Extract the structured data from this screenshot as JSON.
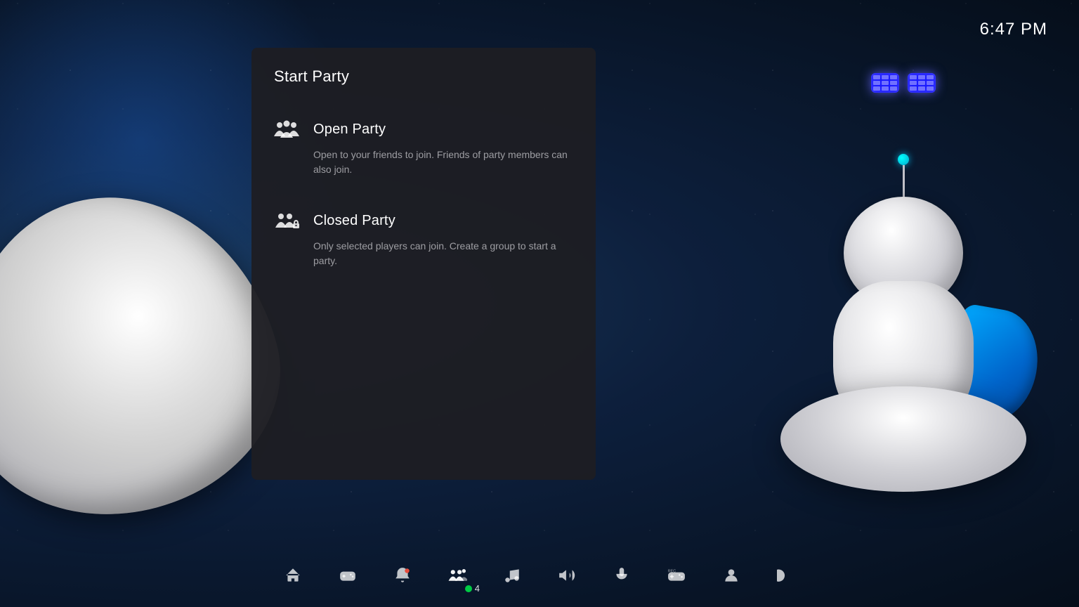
{
  "clock": {
    "time": "6:47 PM"
  },
  "panel": {
    "title": "Start Party",
    "items": [
      {
        "id": "open-party",
        "title": "Open Party",
        "description": "Open to your friends to join. Friends of party members can also join.",
        "icon": "open-party-icon"
      },
      {
        "id": "closed-party",
        "title": "Closed Party",
        "description": "Only selected players can join. Create a group to start a party.",
        "icon": "closed-party-icon"
      }
    ]
  },
  "taskbar": {
    "icons": [
      {
        "id": "home",
        "label": "Home"
      },
      {
        "id": "game",
        "label": "Game"
      },
      {
        "id": "notifications",
        "label": "Notifications"
      },
      {
        "id": "party",
        "label": "Party",
        "active": true,
        "badge": "4"
      },
      {
        "id": "music",
        "label": "Music"
      },
      {
        "id": "volume",
        "label": "Volume"
      },
      {
        "id": "mic",
        "label": "Microphone"
      },
      {
        "id": "accessories",
        "label": "Accessories"
      },
      {
        "id": "profile",
        "label": "Profile"
      },
      {
        "id": "power",
        "label": "Power"
      }
    ],
    "party_count": "4"
  }
}
